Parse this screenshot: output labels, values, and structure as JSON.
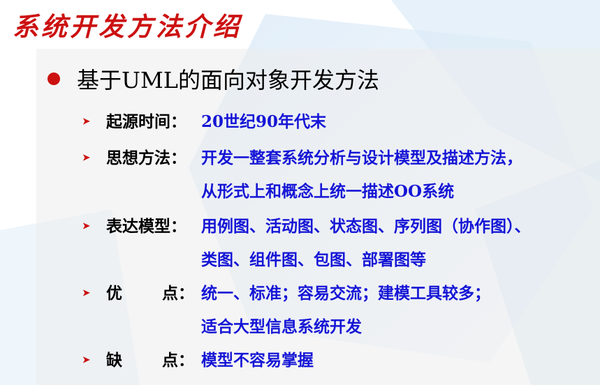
{
  "title": "系统开发方法介绍",
  "heading": "基于UML的面向对象开发方法",
  "items": [
    {
      "label": "起源时间：",
      "lines": [
        "20世纪90年代末"
      ]
    },
    {
      "label": "思想方法：",
      "lines": [
        "开发一整套系统分析与设计模型及描述方法，",
        "从形式上和概念上统一描述OO系统"
      ]
    },
    {
      "label": "表达模型：",
      "lines": [
        "用例图、活动图、状态图、序列图（协作图）、",
        "类图、组件图、包图、部署图等"
      ]
    },
    {
      "label_a": "优",
      "label_b": "点：",
      "lines": [
        "统一、标准；容易交流；建模工具较多；",
        "适合大型信息系统开发"
      ]
    },
    {
      "label_a": "缺",
      "label_b": "点：",
      "lines": [
        "模型不容易掌握"
      ]
    }
  ],
  "colors": {
    "accent": "#cc1111",
    "value_text": "#1515d6",
    "panel": "#ececec"
  },
  "icons": {
    "bullet": "red-dot-icon",
    "sub_bullet": "arrow-right-icon"
  }
}
